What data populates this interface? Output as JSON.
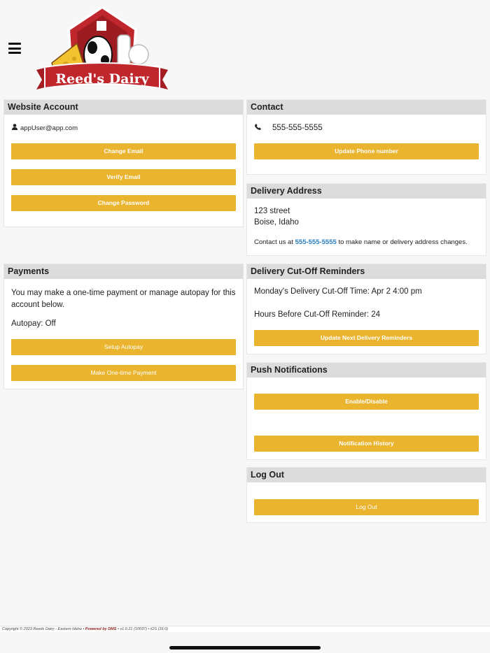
{
  "brand": {
    "logo_text": "Reed's Dairy"
  },
  "website_account": {
    "title": "Website Account",
    "email": "appUser@app.com",
    "change_email": "Change Email",
    "verify_email": "Verify Email",
    "change_password": "Change Password"
  },
  "contact": {
    "title": "Contact",
    "phone": "555-555-5555",
    "update_phone": "Update Phone number"
  },
  "delivery_address": {
    "title": "Delivery Address",
    "line1": "123 street",
    "line2": "Boise, Idaho",
    "note_prefix": "Contact us at",
    "note_phone": "555-555-5555",
    "note_suffix": "to make name or delivery address changes."
  },
  "payments": {
    "title": "Payments",
    "description": "You may make a one-time payment or manage autopay for this account below.",
    "autopay_status": "Autopay: Off",
    "setup_autopay": "Setup Autopay",
    "one_time_payment": "Make One-time Payment"
  },
  "cutoff": {
    "title": "Delivery Cut-Off Reminders",
    "cutoff_time": "Monday's Delivery Cut-Off Time: Apr 2 4:00 pm",
    "hours_before": "Hours Before Cut-Off Reminder: 24",
    "update_button": "Update Next Delivery Reminders"
  },
  "push": {
    "title": "Push Notifications",
    "enable_disable": "Enable/Disable",
    "history": "Notification History"
  },
  "logout": {
    "title": "Log Out",
    "button": "Log Out"
  },
  "footer": {
    "copyright": "Copyright © 2023 Reeds Dairy - Eastern Idaho •",
    "powered": "Powered by DMS",
    "version": "• v1.0.21 (10037) • iOS (16.0)"
  },
  "colors": {
    "accent": "#ebb42f",
    "header_bg": "#dcdcdc",
    "link": "#2a7fc1",
    "brand_red": "#c0272d"
  },
  "icons": {
    "menu": "hamburger-menu-icon",
    "user": "user-icon",
    "phone": "phone-icon"
  }
}
